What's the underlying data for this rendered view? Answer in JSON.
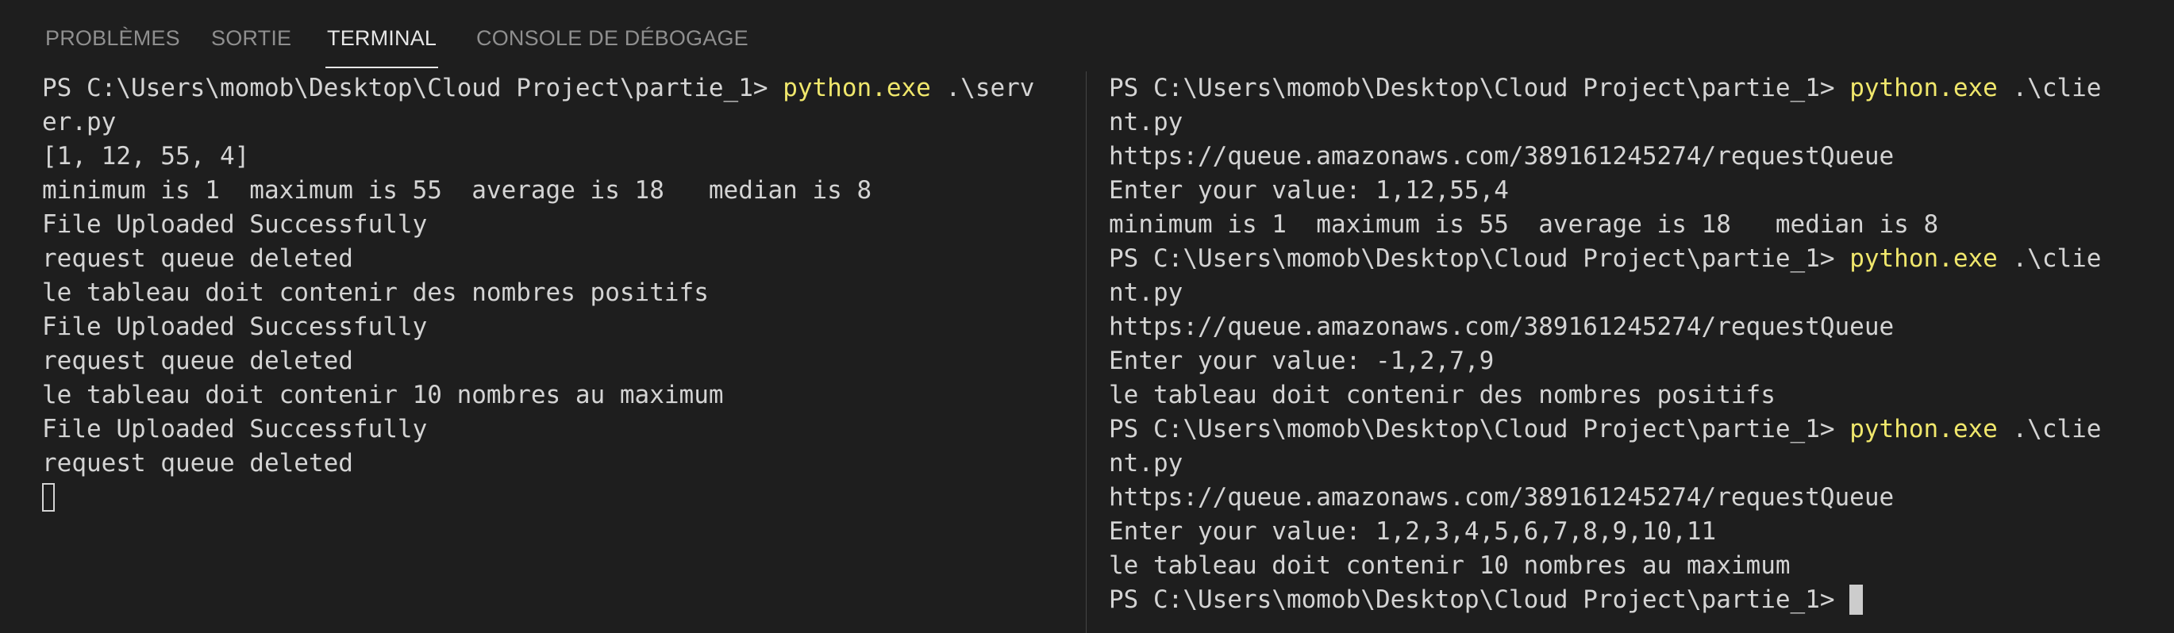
{
  "panel_tabs": [
    {
      "label": "PROBLÈMES"
    },
    {
      "label": "SORTIE"
    },
    {
      "label": "TERMINAL"
    },
    {
      "label": "CONSOLE DE DÉBOGAGE"
    }
  ],
  "terminal_left": {
    "lines": [
      "PS C:\\Users\\momob\\Desktop\\Cloud Project\\partie_1> ",
      "er.py",
      "[1, 12, 55, 4]",
      "minimum is 1  maximum is 55  average is 18   median is 8",
      "File Uploaded Successfully",
      "request queue deleted",
      "le tableau doit contenir des nombres positifs",
      "File Uploaded Successfully",
      "request queue deleted",
      "le tableau doit contenir 10 nombres au maximum",
      "File Uploaded Successfully",
      "request queue deleted"
    ],
    "command": "python.exe",
    "args": " .\\serv"
  },
  "terminal_right": {
    "prompt": "PS C:\\Users\\momob\\Desktop\\Cloud Project\\partie_1> ",
    "command": "python.exe",
    "args": " .\\clie",
    "wrap": "nt.py",
    "queue_url": "https://queue.amazonaws.com/389161245274/requestQueue",
    "run1_input": "Enter your value: 1,12,55,4",
    "run1_output": "minimum is 1  maximum is 55  average is 18   median is 8",
    "run2_input": "Enter your value: -1,2,7,9",
    "run2_output": "le tableau doit contenir des nombres positifs",
    "run3_input": "Enter your value: 1,2,3,4,5,6,7,8,9,10,11",
    "run3_output": "le tableau doit contenir 10 nombres au maximum"
  }
}
